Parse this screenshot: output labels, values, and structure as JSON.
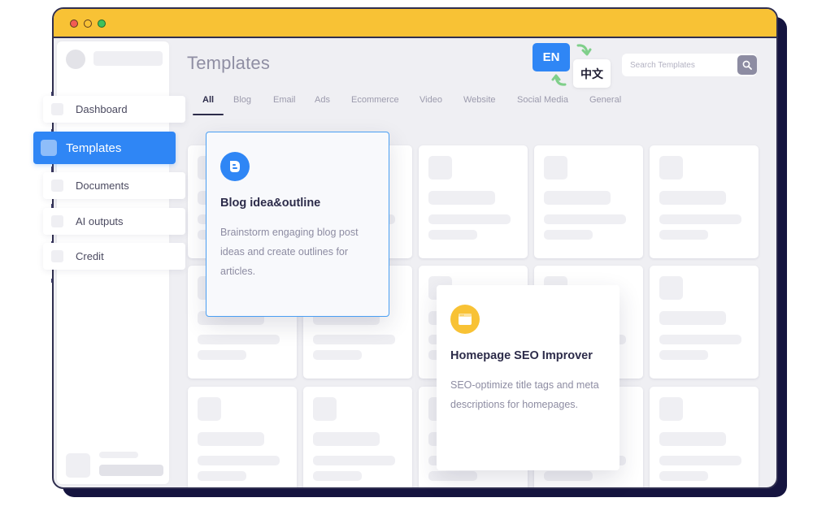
{
  "window": {
    "traffic_lights": [
      {
        "name": "close",
        "color": "#f25c54"
      },
      {
        "name": "minimize",
        "color": "#f8c235"
      },
      {
        "name": "maximize",
        "color": "#3fc15b"
      }
    ],
    "titlebar_color": "#f8c235"
  },
  "header": {
    "title": "Templates",
    "search": {
      "placeholder": "Search Templates",
      "value": ""
    },
    "language": {
      "current": "EN",
      "alternate": "中文"
    }
  },
  "tabs": [
    {
      "label": "All",
      "active": true
    },
    {
      "label": "Blog",
      "active": false
    },
    {
      "label": "Email",
      "active": false
    },
    {
      "label": "Ads",
      "active": false
    },
    {
      "label": "Ecommerce",
      "active": false
    },
    {
      "label": "Video",
      "active": false
    },
    {
      "label": "Website",
      "active": false
    },
    {
      "label": "Social Media",
      "active": false
    },
    {
      "label": "General",
      "active": false
    }
  ],
  "nav": {
    "items": [
      {
        "label": "Dashboard",
        "active": false
      },
      {
        "label": "Templates",
        "active": true
      },
      {
        "label": "Documents",
        "active": false
      },
      {
        "label": "AI outputs",
        "active": false
      },
      {
        "label": "Credit",
        "active": false
      }
    ],
    "accent": "#2f86f5"
  },
  "featured_cards": [
    {
      "title": "Blog idea&outline",
      "description": "Brainstorm engaging blog post ideas and create outlines for articles.",
      "icon": "blogger-icon",
      "icon_color": "#2f86f5",
      "selected": true
    },
    {
      "title": "Homepage SEO Improver",
      "description": "SEO-optimize title tags and meta descriptions for homepages.",
      "icon": "browser-window-icon",
      "icon_color": "#f8c235",
      "selected": false
    }
  ]
}
